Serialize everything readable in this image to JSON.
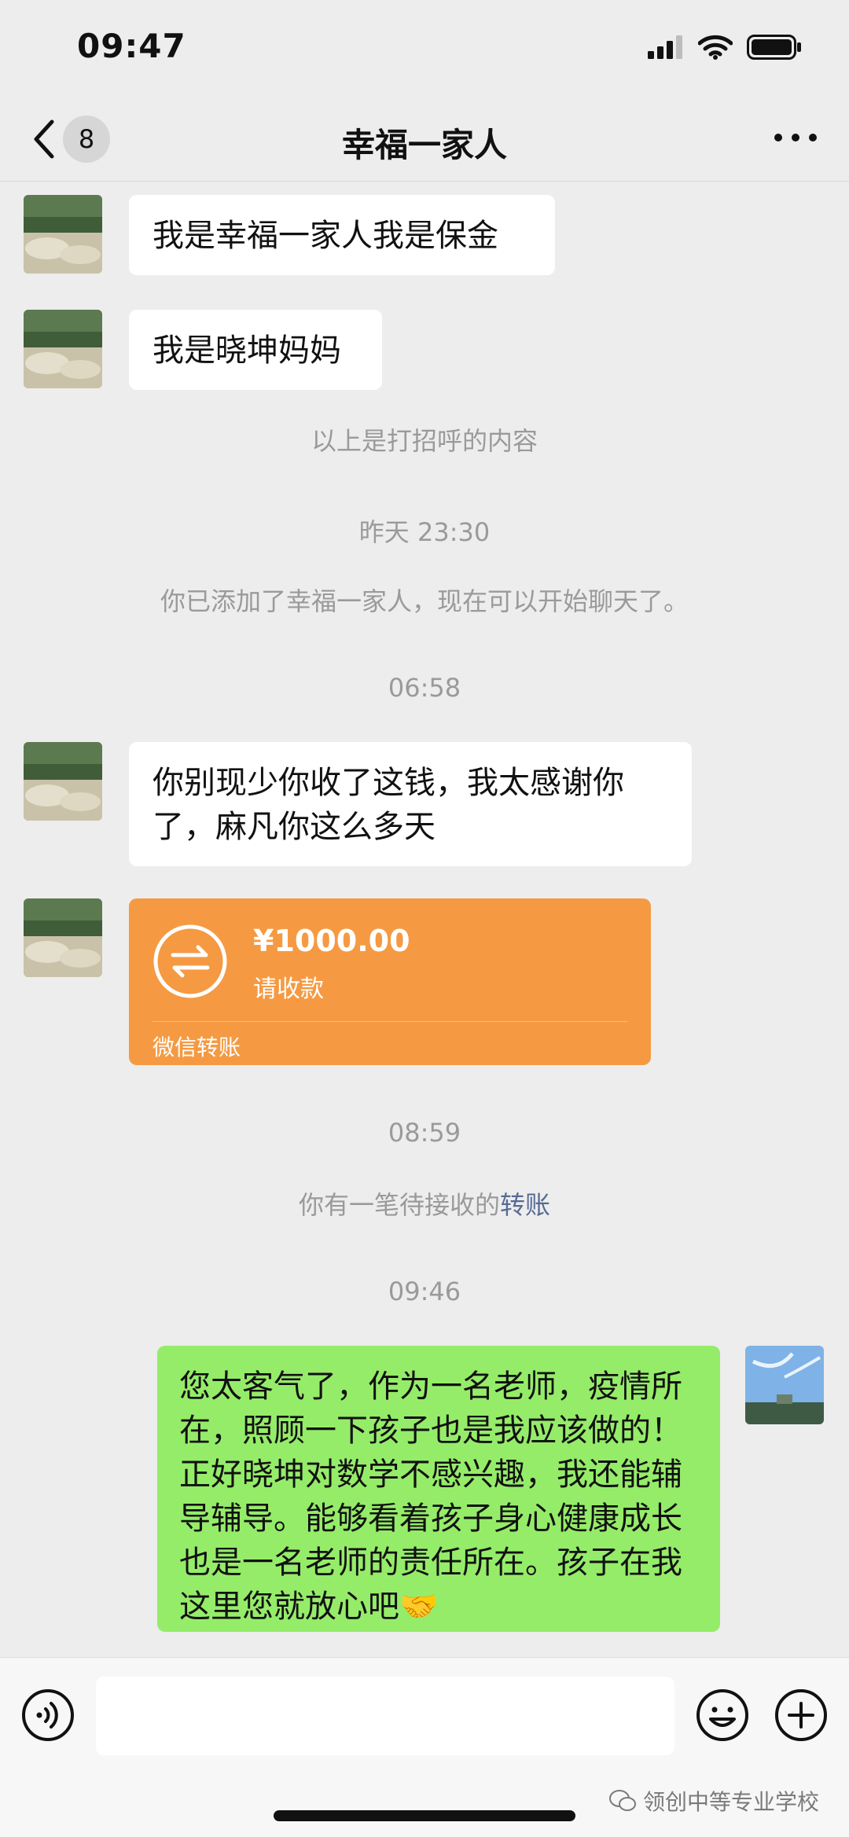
{
  "status": {
    "time": "09:47"
  },
  "nav": {
    "back_count": "8",
    "title": "幸福一家人"
  },
  "messages": [
    {
      "text": "我是幸福一家人我是保金"
    },
    {
      "text": "我是晓坤妈妈"
    },
    {
      "text": "你别现少你收了这钱，我太感谢你了，麻凡你这么多天"
    }
  ],
  "system": {
    "greeting_note": "以上是打招呼的内容",
    "time1": "昨天 23:30",
    "added_note": "你已添加了幸福一家人，现在可以开始聊天了。",
    "time2": "06:58",
    "time3": "08:59",
    "pending_prefix": "你有一笔待接收的",
    "pending_link": "转账",
    "time4": "09:46"
  },
  "transfer": {
    "amount": "¥1000.00",
    "status": "请收款",
    "footer": "微信转账"
  },
  "reply": {
    "text": "您太客气了，作为一名老师，疫情所在，照顾一下孩子也是我应该做的！正好晓坤对数学不感兴趣，我还能辅导辅导。能够看着孩子身心健康成长也是一名老师的责任所在。孩子在我这里您就放心吧🤝"
  },
  "watermark": {
    "text": "领创中等专业学校"
  },
  "colors": {
    "bubble_green": "#95ec69",
    "transfer_orange": "#f59a42",
    "link_blue": "#576b95",
    "background": "#ededed"
  }
}
